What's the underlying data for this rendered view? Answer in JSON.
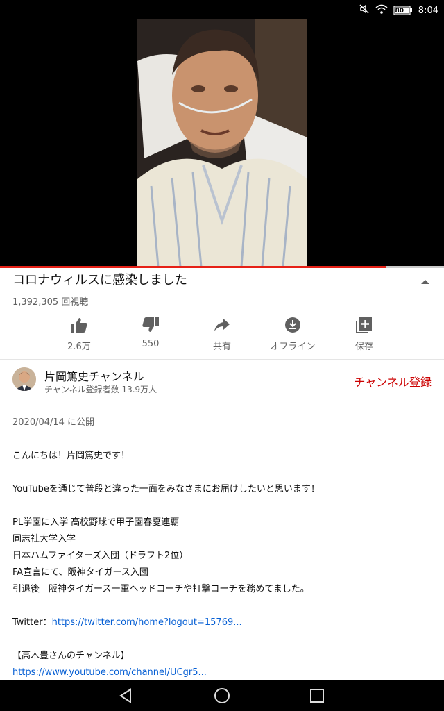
{
  "status_bar": {
    "time": "8:04",
    "battery_level": "80",
    "icons": [
      "mute-icon",
      "wifi-icon",
      "battery-icon"
    ]
  },
  "video": {
    "progress_fraction": 0.87,
    "progress_color": "#e62117"
  },
  "title": "コロナウィルスに感染しました",
  "views": "1,392,305 回視聴",
  "actions": [
    {
      "icon": "thumbs-up-icon",
      "label": "2.6万"
    },
    {
      "icon": "thumbs-down-icon",
      "label": "550"
    },
    {
      "icon": "share-icon",
      "label": "共有"
    },
    {
      "icon": "download-icon",
      "label": "オフライン"
    },
    {
      "icon": "save-playlist-icon",
      "label": "保存"
    }
  ],
  "channel": {
    "name": "片岡篤史チャンネル",
    "subscribers": "チャンネル登録者数 13.9万人",
    "subscribe_label": "チャンネル登録",
    "subscribe_color": "#cc0000"
  },
  "description": {
    "published": "2020/04/14 に公開",
    "greeting": "こんにちは！片岡篤史です！",
    "intro": "YouTubeを通じて普段と違った一面をみなさまにお届けしたいと思います！",
    "bio": [
      "PL学園に入学 高校野球で甲子園春夏連覇",
      "同志社大学入学",
      "日本ハムファイターズ入団（ドラフト2位）",
      "FA宣言にて、阪神タイガース入団",
      "引退後　阪神タイガース一軍ヘッドコーチや打撃コーチを務めてました。"
    ],
    "twitter_label": "Twitter：",
    "twitter_link": "https://twitter.com/home?logout=15769...",
    "takagi_heading": "【高木豊さんのチャンネル】",
    "takagi_link": "https://www.youtube.com/channel/UCgr5..."
  }
}
